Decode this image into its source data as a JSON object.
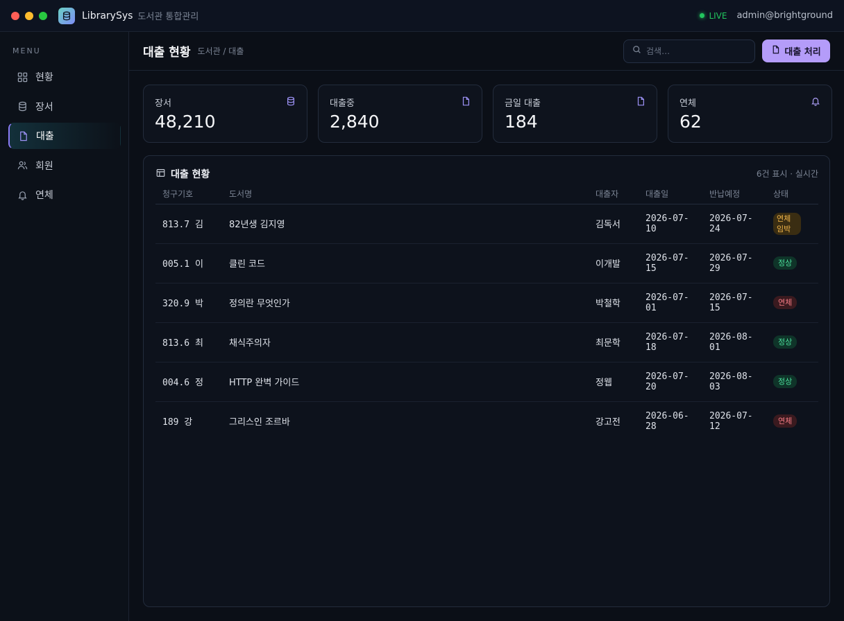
{
  "app": {
    "name": "LibrarySys",
    "subtitle": "도서관 통합관리"
  },
  "status": {
    "live": "LIVE",
    "user": "admin@brightground"
  },
  "sidebar": {
    "menu_label": "MENU",
    "items": [
      {
        "label": "현황",
        "icon": "grid-icon"
      },
      {
        "label": "장서",
        "icon": "database-icon"
      },
      {
        "label": "대출",
        "icon": "document-icon",
        "active": true
      },
      {
        "label": "회원",
        "icon": "users-icon"
      },
      {
        "label": "연체",
        "icon": "bell-icon"
      }
    ]
  },
  "header": {
    "title": "대출 현황",
    "breadcrumb": "도서관 / 대출",
    "search_placeholder": "검색…",
    "primary_button": "대출 처리"
  },
  "stats": [
    {
      "label": "장서",
      "value": "48,210",
      "icon": "database-icon"
    },
    {
      "label": "대출중",
      "value": "2,840",
      "icon": "document-icon"
    },
    {
      "label": "금일 대출",
      "value": "184",
      "icon": "document-icon"
    },
    {
      "label": "연체",
      "value": "62",
      "icon": "bell-icon"
    }
  ],
  "panel": {
    "title": "대출 현황",
    "meta": "6건 표시 · 실시간",
    "columns": [
      "청구기호",
      "도서명",
      "대출자",
      "대출일",
      "반납예정",
      "상태"
    ],
    "rows": [
      {
        "call": "813.7 김",
        "title": "82년생 김지영",
        "borrower": "김독서",
        "loan": "2026-07-10",
        "due": "2026-07-24",
        "status": "연체임박",
        "kind": "soon"
      },
      {
        "call": "005.1 이",
        "title": "클린 코드",
        "borrower": "이개발",
        "loan": "2026-07-15",
        "due": "2026-07-29",
        "status": "정상",
        "kind": "ok"
      },
      {
        "call": "320.9 박",
        "title": "정의란 무엇인가",
        "borrower": "박철학",
        "loan": "2026-07-01",
        "due": "2026-07-15",
        "status": "연체",
        "kind": "over"
      },
      {
        "call": "813.6 최",
        "title": "채식주의자",
        "borrower": "최문학",
        "loan": "2026-07-18",
        "due": "2026-08-01",
        "status": "정상",
        "kind": "ok"
      },
      {
        "call": "004.6 정",
        "title": "HTTP 완벽 가이드",
        "borrower": "정웹",
        "loan": "2026-07-20",
        "due": "2026-08-03",
        "status": "정상",
        "kind": "ok"
      },
      {
        "call": "189 강",
        "title": "그리스인 조르바",
        "borrower": "강고전",
        "loan": "2026-06-28",
        "due": "2026-07-12",
        "status": "연체",
        "kind": "over"
      }
    ]
  },
  "colors": {
    "accent": "#b49cf9",
    "live": "#22c55e",
    "ok": "#4ade9a",
    "overdue": "#f57b84",
    "soon": "#f2b54a"
  }
}
